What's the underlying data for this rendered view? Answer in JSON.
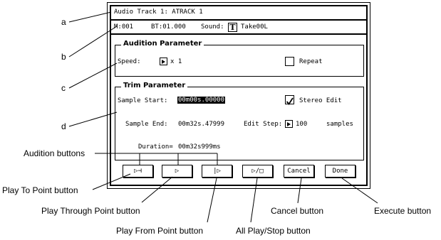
{
  "screen": {
    "title": "Audio Track 1: ATRACK 1",
    "status": {
      "m_label": "M:001",
      "bt_label": "BT:01.000",
      "sound_label": "Sound:",
      "sound_icon_text": "T",
      "sound_value": "Take00L"
    }
  },
  "audition": {
    "title": "Audition Parameter",
    "speed_label": "Speed:",
    "speed_value": "x 1",
    "repeat_label": "Repeat",
    "repeat_checked": false
  },
  "trim": {
    "title": "Trim Parameter",
    "sample_start_label": "Sample Start:",
    "sample_start_value": "00m00s.00000",
    "stereo_edit_label": "Stereo Edit",
    "stereo_edit_checked": true,
    "sample_end_label": "Sample End:",
    "sample_end_value": "00m32s.47999",
    "edit_step_label": "Edit Step:",
    "edit_step_value": "100",
    "edit_step_unit": "samples",
    "duration_label": "Duration=",
    "duration_value": "00m32s999ms"
  },
  "buttons": {
    "play_to_point": "▷⊣",
    "play_through_point": "▷",
    "play_from_point": "|▷",
    "all_play_stop": "▷/□",
    "cancel": "Cancel",
    "done": "Done"
  },
  "callouts": {
    "a": "a",
    "b": "b",
    "c": "c",
    "d": "d",
    "audition_buttons": "Audition buttons",
    "play_to_point": "Play To Point button",
    "play_through_point": "Play Through Point button",
    "play_from_point": "Play From Point button",
    "all_play_stop": "All Play/Stop button",
    "cancel": "Cancel button",
    "execute": "Execute button"
  }
}
